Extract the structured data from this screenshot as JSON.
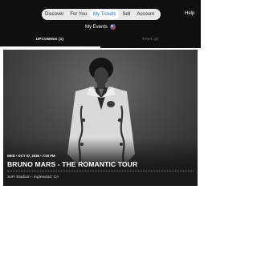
{
  "nav": {
    "items": [
      {
        "label": "Discover"
      },
      {
        "label": "For You"
      },
      {
        "label": "My Tickets",
        "active": true
      },
      {
        "label": "Sell"
      },
      {
        "label": "Account"
      }
    ],
    "help_label": "Help",
    "accent_color": "#1f6fd6"
  },
  "page": {
    "title": "My Events",
    "flag_icon": "us-flag-icon"
  },
  "tabs": [
    {
      "label": "UPCOMING (1)",
      "active": true
    },
    {
      "label": "PAST (2)",
      "active": false
    }
  ],
  "events": [
    {
      "meta": "WED • OCT 07, 2026 • 7:00 PM",
      "title": "BRUNO MARS - THE ROMANTIC TOUR",
      "venue": "SoFi Stadium - Inglewood, CA"
    }
  ]
}
